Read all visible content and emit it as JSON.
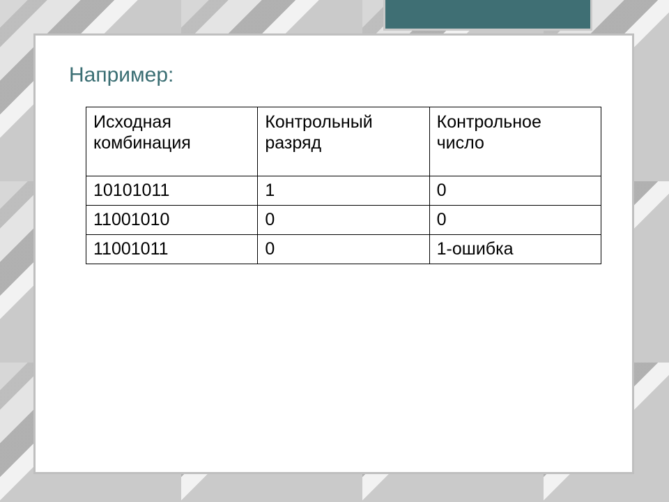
{
  "colors": {
    "accent": "#3f6f74",
    "frame": "#bfbfbf",
    "title": "#3a6e73"
  },
  "title": "Например:",
  "table": {
    "headers": [
      "Исходная комбинация",
      "Контрольный разряд",
      "Контрольное число"
    ],
    "rows": [
      {
        "c0": "10101011",
        "c1": "1",
        "c2": "0"
      },
      {
        "c0": "11001010",
        "c1": "0",
        "c2": "0"
      },
      {
        "c0": "11001011",
        "c1": "0",
        "c2": "1-ошибка"
      }
    ]
  }
}
